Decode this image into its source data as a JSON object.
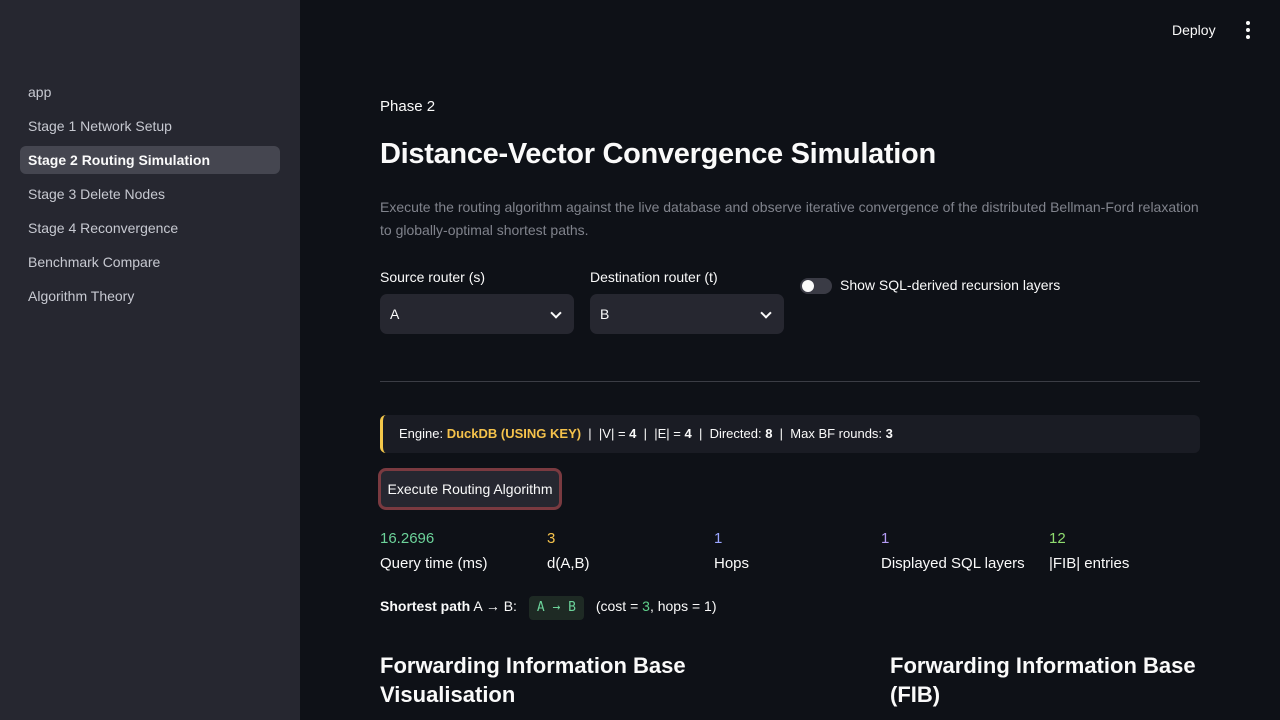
{
  "sidebar": {
    "items": [
      {
        "label": "app",
        "active": false
      },
      {
        "label": "Stage 1 Network Setup",
        "active": false
      },
      {
        "label": "Stage 2 Routing Simulation",
        "active": true
      },
      {
        "label": "Stage 3 Delete Nodes",
        "active": false
      },
      {
        "label": "Stage 4 Reconvergence",
        "active": false
      },
      {
        "label": "Benchmark Compare",
        "active": false
      },
      {
        "label": "Algorithm Theory",
        "active": false
      }
    ]
  },
  "topbar": {
    "deploy_label": "Deploy",
    "menu_icon": "kebab-menu-icon"
  },
  "main": {
    "phase": "Phase 2",
    "title": "Distance-Vector Convergence Simulation",
    "description": "Execute the routing algorithm against the live database and observe iterative convergence of the distributed Bellman-Ford relaxation to globally-optimal shortest paths.",
    "source": {
      "label": "Source router (s)",
      "value": "A"
    },
    "destination": {
      "label": "Destination router (t)",
      "value": "B"
    },
    "toggle": {
      "label": "Show SQL-derived recursion layers",
      "on": false
    },
    "info": {
      "engine_prefix": "Engine:",
      "engine": "DuckDB (USING KEY)",
      "v_label": "|V| =",
      "v_value": "4",
      "e_label": "|E| =",
      "e_value": "4",
      "directed_label": "Directed:",
      "directed_value": "8",
      "rounds_label": "Max BF rounds:",
      "rounds_value": "3",
      "accent_color": "#f3c74a"
    },
    "execute_button": "Execute Routing Algorithm",
    "metrics": [
      {
        "value": "16.2696",
        "label": "Query time (ms)",
        "color": "#6cd39a"
      },
      {
        "value": "3",
        "label": "d(A,B)",
        "color": "#f5c24b"
      },
      {
        "value": "1",
        "label": "Hops",
        "color": "#9aa6ff"
      },
      {
        "value": "1",
        "label": "Displayed SQL layers",
        "color": "#b59cf5"
      },
      {
        "value": "12",
        "label": "|FIB| entries",
        "color": "#8fdc6f"
      }
    ],
    "path": {
      "lead": "Shortest path",
      "route": "A → B:",
      "chip": "A → B",
      "cost_prefix": "(cost =",
      "cost_value": "3",
      "hops_prefix": ", hops =",
      "hops_value": "1",
      "suffix": ")"
    },
    "section_left": "Forwarding Information Base Visualisation",
    "section_right": "Forwarding Information Base (FIB)"
  }
}
